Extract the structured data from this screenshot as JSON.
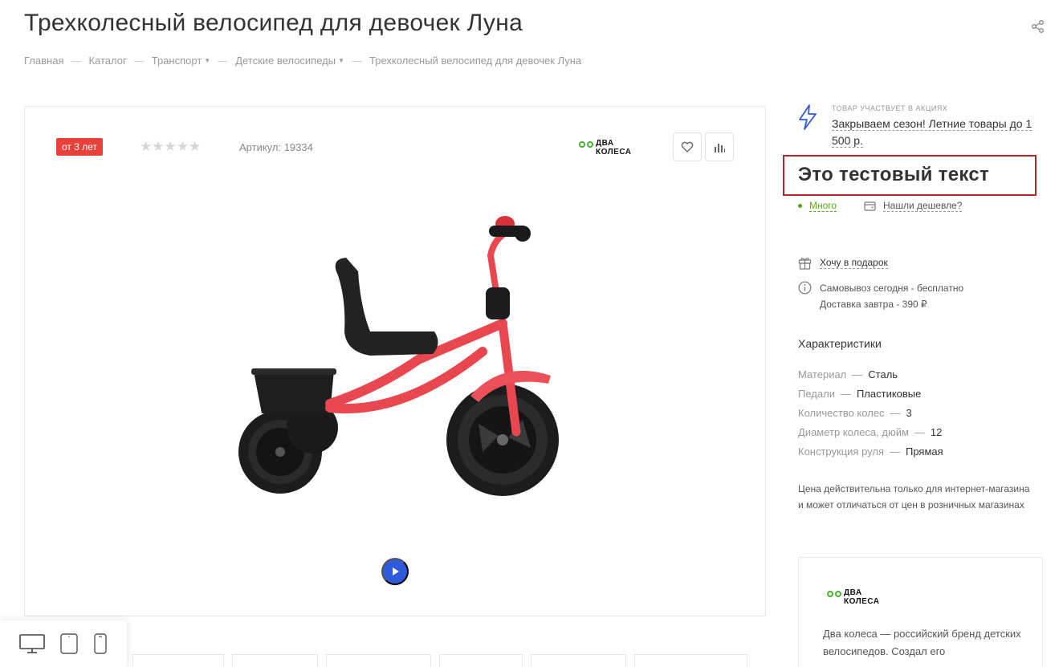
{
  "product": {
    "title": "Трехколесный велосипед для девочек Луна",
    "age_badge": "от 3 лет",
    "rating_stars": "★★★★★",
    "sku": "Артикул: 19334"
  },
  "breadcrumb": {
    "items": [
      "Главная",
      "Каталог",
      "Транспорт",
      "Детские велосипеды",
      "Трехколесный велосипед для девочек Луна"
    ],
    "separator": "—"
  },
  "brand": {
    "name_line1": "ДВА",
    "name_line2": "КОЛЕСА",
    "description": "Два колеса — российский бренд детских велосипедов. Создал его"
  },
  "promo": {
    "label": "Товар участвует в акциях",
    "link": "Закрываем сезон! Летние товары до 1 500 р."
  },
  "highlight_text": "Это тестовый текст",
  "stock": {
    "status": "Много",
    "cheaper": "Нашли дешевле?"
  },
  "gift": "Хочу в подарок",
  "delivery": {
    "pickup": "Самовывоз сегодня - бесплатно",
    "shipping": "Доставка завтра - 390 ₽"
  },
  "specs": {
    "title": "Характеристики",
    "rows": [
      {
        "key": "Материал",
        "value": "Сталь"
      },
      {
        "key": "Педали",
        "value": "Пластиковые"
      },
      {
        "key": "Количество колес",
        "value": "3"
      },
      {
        "key": "Диаметр колеса, дюйм",
        "value": "12"
      },
      {
        "key": "Конструкция руля",
        "value": "Прямая"
      }
    ]
  },
  "price_note": "Цена действительна только для интернет-магазина и может отличаться от цен в розничных магазинах",
  "colors": {
    "badge": "#e8413a",
    "stock": "#5aa51a",
    "play": "#2e5bd8",
    "highlight_border": "#b32327",
    "bike_frame": "#e8474f"
  },
  "icons": [
    "share-icon",
    "heart-icon",
    "compare-icon",
    "play-icon",
    "lightning-icon",
    "wallet-icon",
    "gift-icon",
    "info-icon",
    "desktop-icon",
    "tablet-icon",
    "mobile-icon"
  ]
}
